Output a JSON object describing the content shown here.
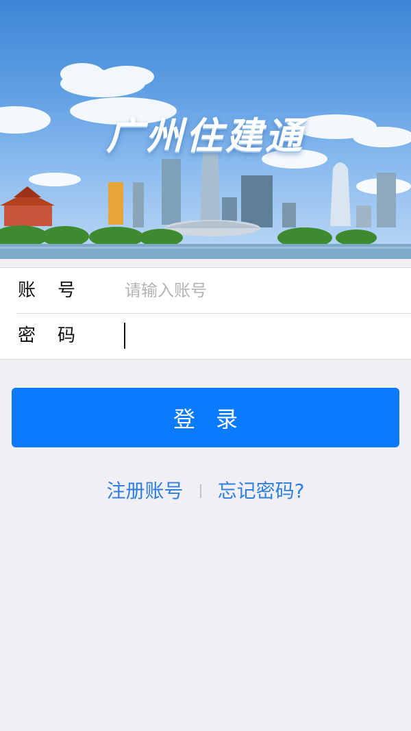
{
  "banner": {
    "title": "广州住建通"
  },
  "form": {
    "account_label": "账号",
    "account_placeholder": "请输入账号",
    "account_value": "",
    "password_label": "密码",
    "password_value": ""
  },
  "login_button": {
    "label": "登录"
  },
  "links": {
    "register": "注册账号",
    "separator": "|",
    "forgot": "忘记密码?"
  },
  "colors": {
    "accent": "#0a7aff",
    "link": "#2f7fe0",
    "background": "#efeff4"
  },
  "icons": [
    "skyline-illustration"
  ]
}
